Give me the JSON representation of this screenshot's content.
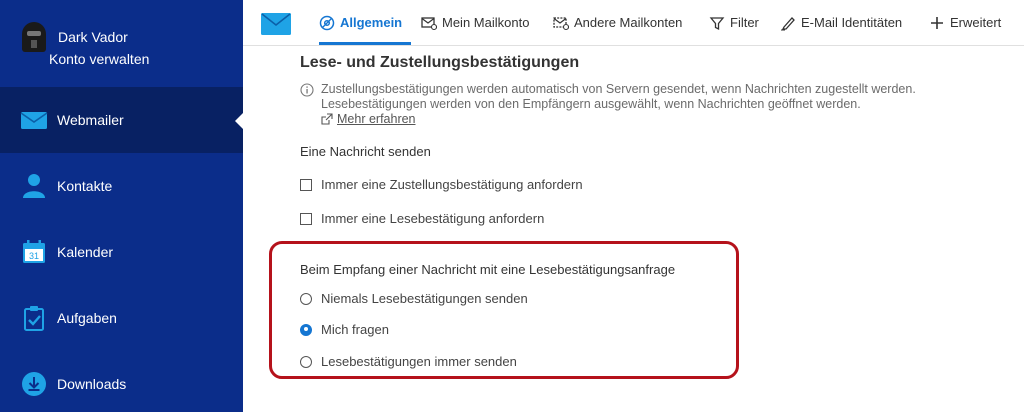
{
  "account": {
    "name": "Dark Vador",
    "manage_label": "Konto verwalten",
    "avatar_icon": "darth-vader-avatar-icon"
  },
  "sidebar": {
    "items": [
      {
        "label": "Webmailer",
        "icon": "envelope-icon",
        "active": true
      },
      {
        "label": "Kontakte",
        "icon": "person-icon",
        "active": false
      },
      {
        "label": "Kalender",
        "icon": "calendar-icon",
        "active": false,
        "icon_text": "31"
      },
      {
        "label": "Aufgaben",
        "icon": "clipboard-check-icon",
        "active": false
      },
      {
        "label": "Downloads",
        "icon": "download-icon",
        "active": false
      }
    ]
  },
  "tabs": [
    {
      "label": "Allgemein",
      "icon": "general-settings-icon",
      "active": true
    },
    {
      "label": "Mein Mailkonto",
      "icon": "mail-account-icon",
      "active": false
    },
    {
      "label": "Andere Mailkonten",
      "icon": "other-mail-accounts-icon",
      "active": false
    },
    {
      "label": "Filter",
      "icon": "filter-icon",
      "active": false
    },
    {
      "label": "E-Mail Identitäten",
      "icon": "signature-pen-icon",
      "active": false
    },
    {
      "label": "Erweitert",
      "icon": "plus-icon",
      "active": false
    }
  ],
  "section": {
    "title": "Lese- und Zustellungsbestätigungen",
    "info_line1": "Zustellungsbestätigungen werden automatisch von Servern gesendet, wenn Nachrichten zugestellt werden.",
    "info_line2": "Lesebestätigungen werden von den Empfängern ausgewählt, wenn Nachrichten geöffnet werden.",
    "more_link": "Mehr erfahren"
  },
  "send": {
    "heading": "Eine Nachricht senden",
    "options": [
      {
        "label": "Immer eine Zustellungsbestätigung anfordern",
        "checked": false
      },
      {
        "label": "Immer eine Lesebestätigung anfordern",
        "checked": false
      }
    ]
  },
  "receive": {
    "heading": "Beim Empfang einer Nachricht mit eine Lesebestätigungsanfrage",
    "options": [
      {
        "label": "Niemals Lesebestätigungen senden",
        "selected": false
      },
      {
        "label": "Mich fragen",
        "selected": true
      },
      {
        "label": "Lesebestätigungen immer senden",
        "selected": false
      }
    ]
  },
  "colors": {
    "sidebar": "#0b2d8a",
    "sidebar_active": "#082163",
    "accent": "#1576d2",
    "highlight_border": "#b5121b",
    "icon_cyan": "#1fa3e6"
  }
}
